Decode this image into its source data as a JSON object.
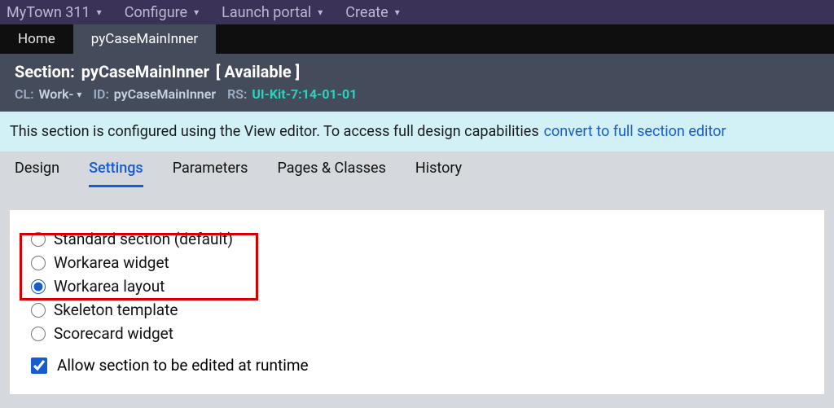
{
  "top_menu": {
    "items": [
      {
        "label": "MyTown 311"
      },
      {
        "label": "Configure"
      },
      {
        "label": "Launch portal"
      },
      {
        "label": "Create"
      }
    ]
  },
  "tabs": {
    "items": [
      {
        "label": "Home",
        "active": false
      },
      {
        "label": "pyCaseMainInner",
        "active": true
      }
    ]
  },
  "ruleform": {
    "type_label": "Section:",
    "name": "pyCaseMainInner",
    "status": "[ Available ]",
    "cl_label": "CL:",
    "cl_value": "Work-",
    "id_label": "ID:",
    "id_value": "pyCaseMainInner",
    "rs_label": "RS:",
    "rs_value": "UI-Kit-7:14-01-01"
  },
  "info_banner": {
    "text": "This section is configured using the View editor. To access full design capabilities",
    "link": "convert to full section editor"
  },
  "inner_tabs": {
    "items": [
      {
        "label": "Design"
      },
      {
        "label": "Settings",
        "active": true
      },
      {
        "label": "Parameters"
      },
      {
        "label": "Pages & Classes"
      },
      {
        "label": "History"
      }
    ]
  },
  "settings": {
    "radios": [
      {
        "label": "Standard section (default)",
        "checked": false
      },
      {
        "label": "Workarea widget",
        "checked": false
      },
      {
        "label": "Workarea layout",
        "checked": true
      },
      {
        "label": "Skeleton template",
        "checked": false
      },
      {
        "label": "Scorecard widget",
        "checked": false
      }
    ],
    "checkbox": {
      "label": "Allow section to be edited at runtime",
      "checked": true
    }
  }
}
